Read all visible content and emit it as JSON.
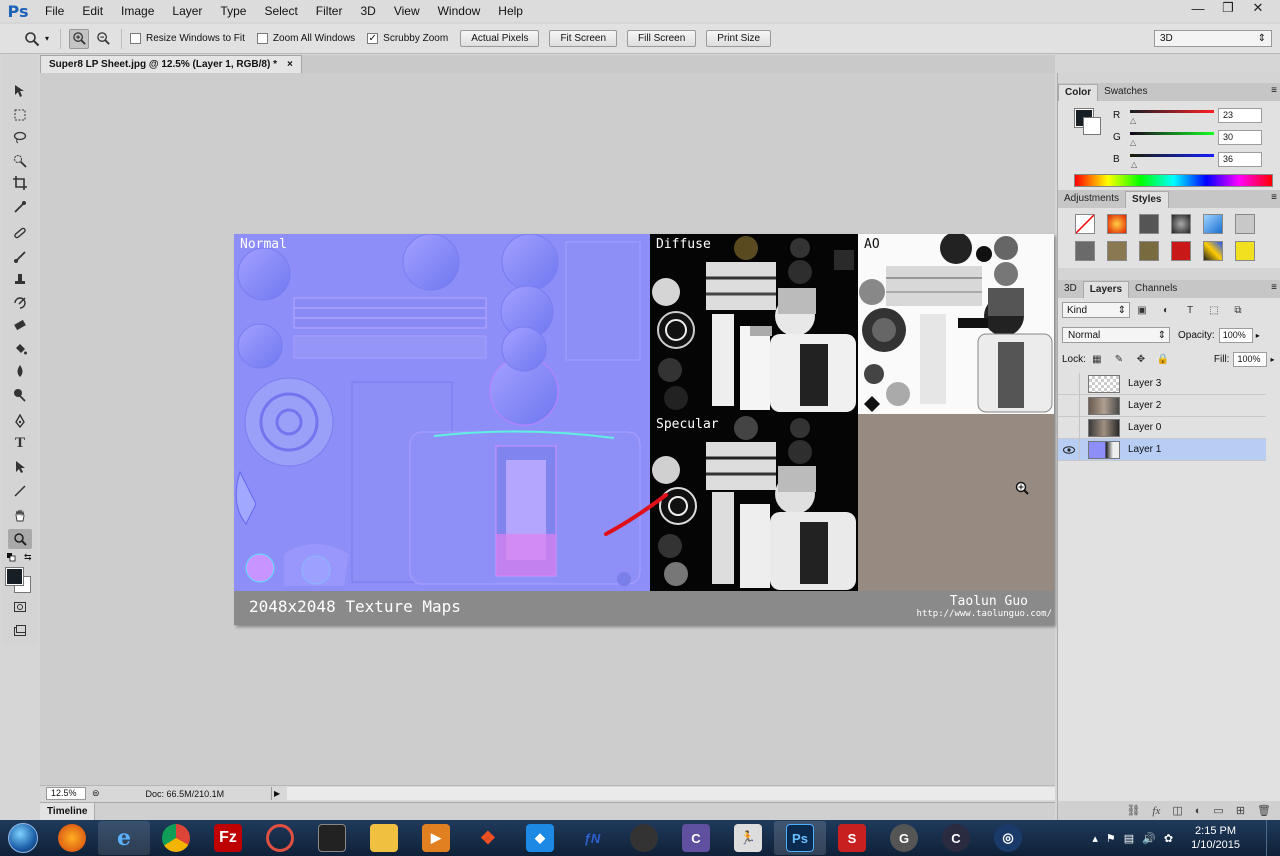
{
  "app": {
    "logo": "Ps",
    "menus": [
      "File",
      "Edit",
      "Image",
      "Layer",
      "Type",
      "Select",
      "Filter",
      "3D",
      "View",
      "Window",
      "Help"
    ],
    "window_controls": [
      "—",
      "❐",
      "✕"
    ]
  },
  "options_bar": {
    "resize_windows_label": "Resize Windows to Fit",
    "resize_windows_checked": false,
    "zoom_all_label": "Zoom All Windows",
    "zoom_all_checked": false,
    "scrubby_zoom_label": "Scrubby Zoom",
    "scrubby_zoom_checked": true,
    "buttons": [
      "Actual Pixels",
      "Fit Screen",
      "Fill Screen",
      "Print Size"
    ],
    "workspace": "3D"
  },
  "document": {
    "tab_title": "Super8 LP Sheet.jpg @ 12.5% (Layer 1, RGB/8) *",
    "close": "×",
    "maps": {
      "normal": "Normal",
      "diffuse": "Diffuse",
      "ao": "AO",
      "specular": "Specular"
    },
    "footer_title": "2048x2048 Texture Maps",
    "author": "Taolun Guo",
    "url": "http://www.taolunguo.com/"
  },
  "status": {
    "zoom": "12.5%",
    "doc_info": "Doc: 66.5M/210.1M"
  },
  "timeline": {
    "label": "Timeline"
  },
  "color_panel": {
    "tabs": [
      "Color",
      "Swatches"
    ],
    "active_tab": "Color",
    "r_label": "R",
    "g_label": "G",
    "b_label": "B",
    "r": "23",
    "g": "30",
    "b": "36",
    "foreground": "#171e24",
    "background": "#ffffff"
  },
  "styles_panel": {
    "tabs": [
      "Adjustments",
      "Styles"
    ],
    "active_tab": "Styles"
  },
  "layers_panel": {
    "tabs": [
      "3D",
      "Layers",
      "Channels"
    ],
    "active_tab": "Layers",
    "kind": "Kind",
    "blend_mode": "Normal",
    "opacity_label": "Opacity:",
    "opacity": "100%",
    "lock_label": "Lock:",
    "fill_label": "Fill:",
    "fill": "100%",
    "layers": [
      {
        "name": "Layer 3",
        "visible": false,
        "selected": false
      },
      {
        "name": "Layer 2",
        "visible": false,
        "selected": false
      },
      {
        "name": "Layer 0",
        "visible": false,
        "selected": false
      },
      {
        "name": "Layer 1",
        "visible": true,
        "selected": true
      }
    ]
  },
  "taskbar": {
    "clock_time": "2:15 PM",
    "clock_date": "1/10/2015"
  }
}
